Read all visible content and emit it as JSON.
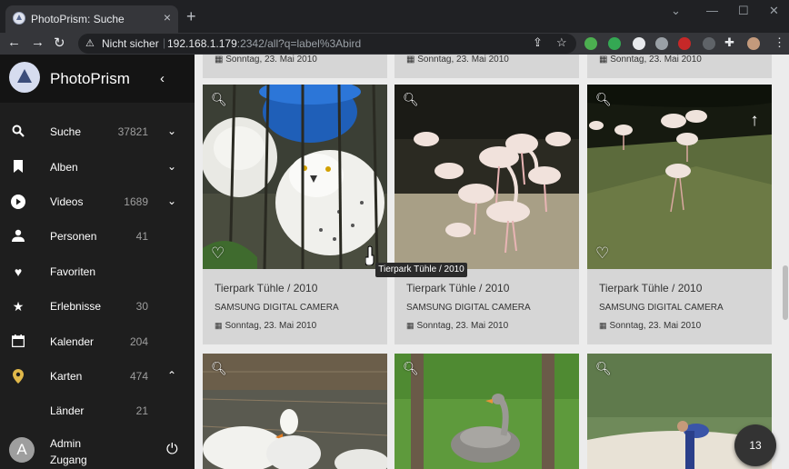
{
  "browser": {
    "tab_title": "PhotoPrism: Suche",
    "tab_close": "×",
    "new_tab": "+",
    "security_label": "Nicht sicher",
    "url_host": "192.168.1.179",
    "url_rest": ":2342/all?q=label%3Abird"
  },
  "sidebar": {
    "brand": "PhotoPrism",
    "items": [
      {
        "label": "Suche",
        "count": "37821",
        "icon": "search-icon",
        "chevron": "chevron-down"
      },
      {
        "label": "Alben",
        "count": "",
        "icon": "bookmark-icon",
        "chevron": "chevron-down"
      },
      {
        "label": "Videos",
        "count": "1689",
        "icon": "play-icon",
        "chevron": "chevron-down"
      },
      {
        "label": "Personen",
        "count": "41",
        "icon": "person-icon",
        "chevron": ""
      },
      {
        "label": "Favoriten",
        "count": "",
        "icon": "heart-icon",
        "chevron": ""
      },
      {
        "label": "Erlebnisse",
        "count": "30",
        "icon": "star-icon",
        "chevron": ""
      },
      {
        "label": "Kalender",
        "count": "204",
        "icon": "calendar-icon",
        "chevron": ""
      },
      {
        "label": "Karten",
        "count": "474",
        "icon": "map-pin-icon",
        "chevron": "chevron-up"
      },
      {
        "label": "Länder",
        "count": "21",
        "icon": "",
        "chevron": ""
      }
    ],
    "user": {
      "initial": "A",
      "name": "Admin",
      "role": "Zugang"
    }
  },
  "top_captions": [
    "Sonntag, 23. Mai 2010",
    "Sonntag, 23. Mai 2010",
    "Sonntag, 23. Mai 2010"
  ],
  "cards": [
    {
      "title": "Tierpark Tühle / 2010",
      "camera": "SAMSUNG DIGITAL CAMERA",
      "date": "Sonntag, 23. Mai 2010"
    },
    {
      "title": "Tierpark Tühle / 2010",
      "camera": "SAMSUNG DIGITAL CAMERA",
      "date": "Sonntag, 23. Mai 2010"
    },
    {
      "title": "Tierpark Tühle / 2010",
      "camera": "SAMSUNG DIGITAL CAMERA",
      "date": "Sonntag, 23. Mai 2010"
    }
  ],
  "tooltip": "Tierpark Tühle / 2010",
  "selection_count": "13",
  "colors": {
    "sidebar_bg": "#1e1e1e",
    "brand_bg": "#141414",
    "active_pin": "#e0b84a",
    "card_bg": "#d6d6d6"
  }
}
